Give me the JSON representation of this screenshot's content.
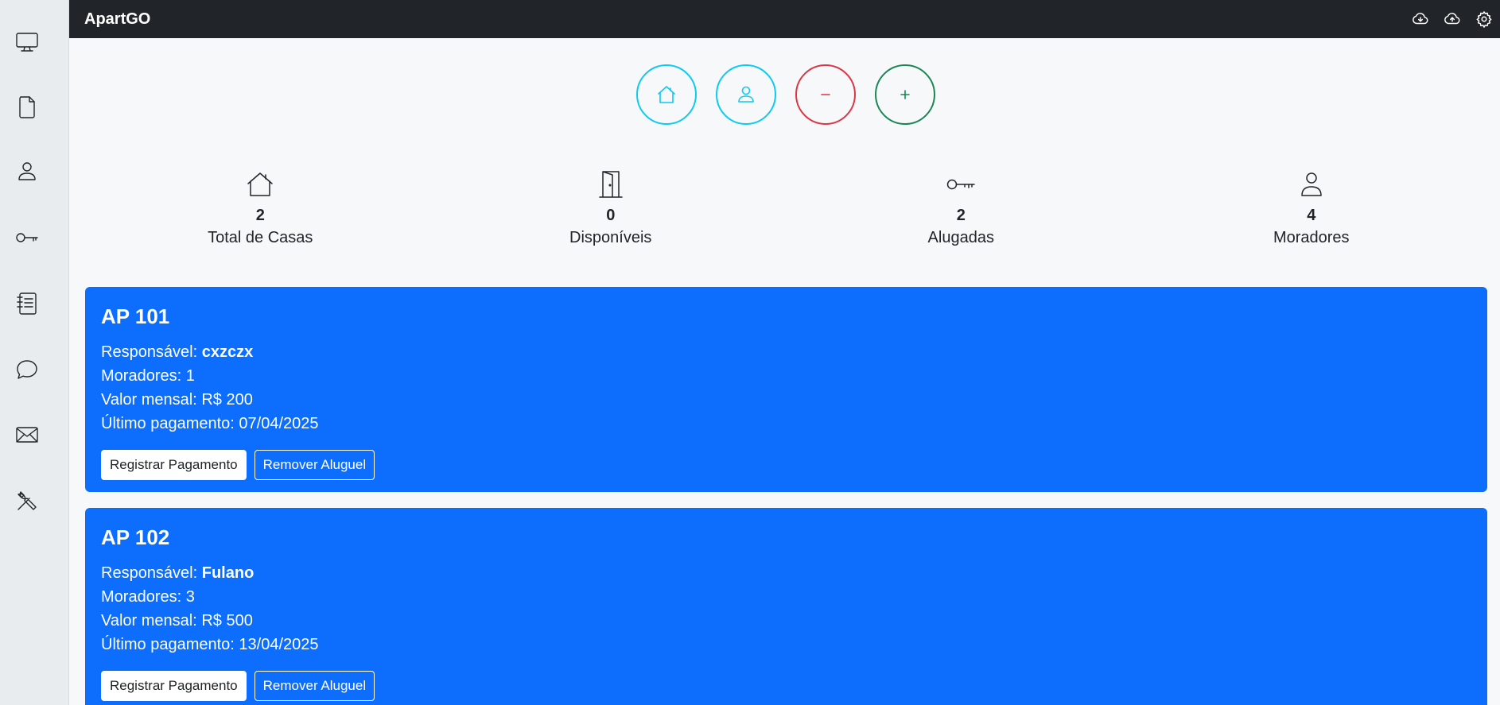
{
  "app": {
    "title": "ApartGO"
  },
  "sidebar": {
    "items": [
      {
        "icon": "monitor-icon"
      },
      {
        "icon": "document-icon"
      },
      {
        "icon": "person-icon"
      },
      {
        "icon": "key-icon"
      },
      {
        "icon": "journal-list-icon"
      },
      {
        "icon": "chat-icon"
      },
      {
        "icon": "envelope-icon"
      },
      {
        "icon": "tools-icon"
      }
    ]
  },
  "topbar": {
    "icons": [
      "cloud-download-icon",
      "cloud-upload-icon",
      "gear-icon"
    ]
  },
  "actions": [
    {
      "icon": "house-icon",
      "color": "#0dcaf0"
    },
    {
      "icon": "person-icon",
      "color": "#0dcaf0"
    },
    {
      "icon": "minus-icon",
      "color": "#dc3545"
    },
    {
      "icon": "plus-icon",
      "color": "#198754"
    }
  ],
  "stats": [
    {
      "icon": "house-icon",
      "value": "2",
      "label": "Total de Casas"
    },
    {
      "icon": "door-icon",
      "value": "0",
      "label": "Disponíveis"
    },
    {
      "icon": "key-icon",
      "value": "2",
      "label": "Alugadas"
    },
    {
      "icon": "person-icon",
      "value": "4",
      "label": "Moradores"
    }
  ],
  "labels": {
    "responsavel": "Responsável:",
    "pay_button": "Registrar Pagamento",
    "remove_button": "Remover Aluguel"
  },
  "apartments": [
    {
      "title": "AP 101",
      "responsavel": "cxzczx",
      "moradores": "Moradores: 1",
      "valor": "Valor mensal: R$ 200",
      "ultimo_pagamento": "Último pagamento: 07/04/2025"
    },
    {
      "title": "AP 102",
      "responsavel": "Fulano",
      "moradores": "Moradores: 3",
      "valor": "Valor mensal: R$ 500",
      "ultimo_pagamento": "Último pagamento: 13/04/2025"
    }
  ],
  "colors": {
    "primary": "#0d6efd",
    "topbar": "#212529",
    "sidebar": "#e9ecef",
    "info": "#0dcaf0",
    "danger": "#dc3545",
    "success": "#198754"
  }
}
